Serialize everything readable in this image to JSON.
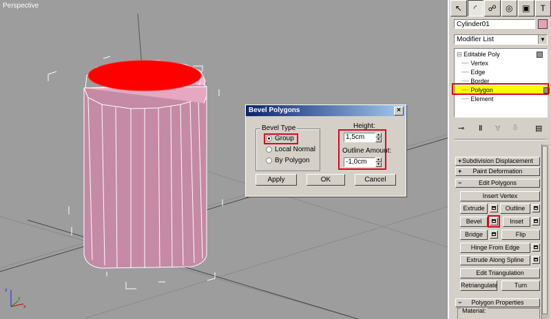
{
  "viewport": {
    "label": "Perspective",
    "axes": {
      "x": "x",
      "y": "y",
      "z": "z"
    }
  },
  "dialog": {
    "title": "Bevel Polygons",
    "close_glyph": "×",
    "bevel_type": {
      "title": "Bevel Type",
      "options": [
        "Group",
        "Local Normal",
        "By Polygon"
      ],
      "selected": "Group"
    },
    "height": {
      "label": "Height:",
      "value": "1,5cm"
    },
    "outline": {
      "label": "Outline Amount:",
      "value": "-1,0cm"
    },
    "buttons": {
      "apply": "Apply",
      "ok": "OK",
      "cancel": "Cancel"
    }
  },
  "panel": {
    "object_name": "Cylinder01",
    "object_color": "#e8a0b8",
    "modifier_list": "Modifier List",
    "stack": {
      "root": "Editable Poly",
      "items": [
        "Vertex",
        "Edge",
        "Border",
        "Polygon",
        "Element"
      ],
      "selected": "Polygon"
    },
    "rollouts": {
      "subdivision_displacement": "Subdivision Displacement",
      "paint_deformation": "Paint Deformation",
      "edit_polygons": "Edit Polygons",
      "polygon_properties": "Polygon Properties"
    },
    "edit_polygons": {
      "insert_vertex": "Insert Vertex",
      "extrude": "Extrude",
      "outline": "Outline",
      "bevel": "Bevel",
      "inset": "Inset",
      "bridge": "Bridge",
      "flip": "Flip",
      "hinge_from_edge": "Hinge From Edge",
      "extrude_along_spline": "Extrude Along Spline",
      "edit_triangulation": "Edit Triangulation",
      "retriangulate": "Retriangulate",
      "turn": "Turn"
    },
    "material_label": "Material:"
  },
  "colors": {
    "highlight": "#e00020",
    "selected_face": "#ff0000",
    "cylinder": "#c08098",
    "viewport_bg": "#9d9d9d"
  }
}
